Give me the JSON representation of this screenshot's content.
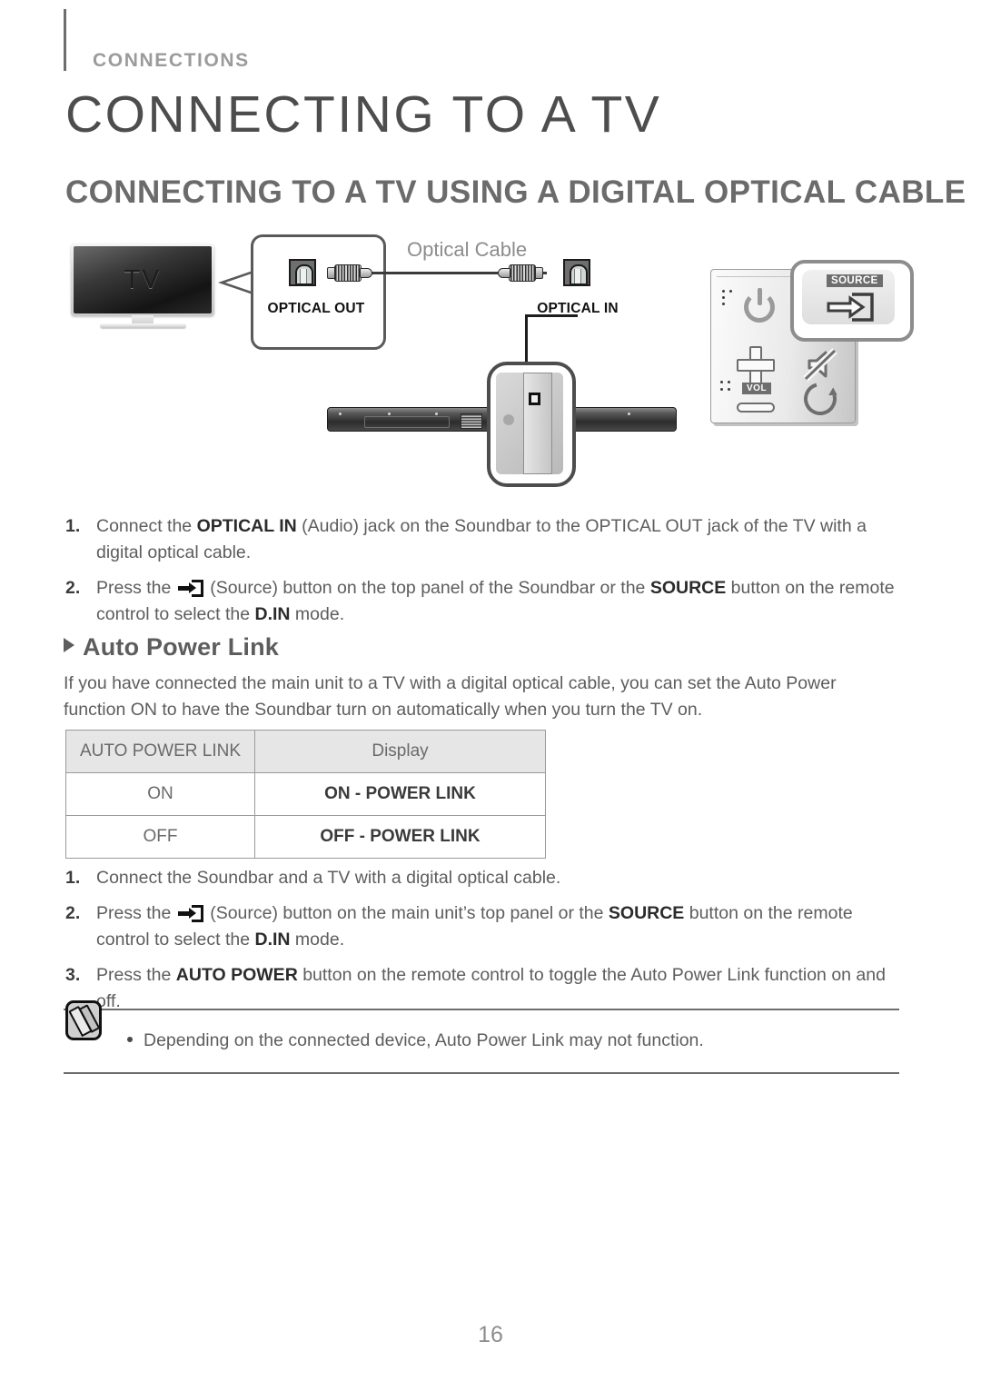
{
  "header": {
    "eyebrow": "CONNECTIONS"
  },
  "titles": {
    "h1": "CONNECTING TO A TV",
    "h2": "CONNECTING TO A TV USING A DIGITAL OPTICAL CABLE"
  },
  "diagram": {
    "tv_label": "TV",
    "optical_out_label": "OPTICAL OUT",
    "optical_in_label": "OPTICAL IN",
    "optical_cable_label": "Optical Cable",
    "source_badge": "SOURCE",
    "vol_badge": "VOL"
  },
  "steps_top": [
    {
      "num": "1.",
      "parts": [
        {
          "t": "Connect the ",
          "b": false
        },
        {
          "t": "OPTICAL IN",
          "b": true
        },
        {
          "t": " (Audio) jack on the Soundbar to the OPTICAL OUT jack of the TV with a digital optical cable.",
          "b": false
        }
      ]
    },
    {
      "num": "2.",
      "parts": [
        {
          "t": "Press the ",
          "b": false
        },
        {
          "t": "[SOURCE-ICON]",
          "b": false,
          "icon": "source-icon"
        },
        {
          "t": " (Source) button on the top panel of the Soundbar or the ",
          "b": false
        },
        {
          "t": "SOURCE",
          "b": true
        },
        {
          "t": " button on the remote control to select the ",
          "b": false
        },
        {
          "t": "D.IN",
          "b": true
        },
        {
          "t": " mode.",
          "b": false
        }
      ]
    }
  ],
  "subhead": {
    "label": "Auto Power Link"
  },
  "intro_paragraph": "If you have connected the main unit to a TV with a digital optical cable, you can set the Auto Power function ON to have the Soundbar turn on automatically when you turn the TV on.",
  "table": {
    "headers": [
      "AUTO POWER LINK",
      "Display"
    ],
    "rows": [
      {
        "setting": "ON",
        "display": "ON - POWER LINK"
      },
      {
        "setting": "OFF",
        "display": "OFF - POWER LINK"
      }
    ]
  },
  "steps_bottom": [
    {
      "num": "1.",
      "parts": [
        {
          "t": "Connect the Soundbar and a TV with a digital optical cable.",
          "b": false
        }
      ]
    },
    {
      "num": "2.",
      "parts": [
        {
          "t": "Press the ",
          "b": false
        },
        {
          "t": "[SOURCE-ICON]",
          "b": false,
          "icon": "source-icon"
        },
        {
          "t": " (Source) button on the main unit’s top panel or the ",
          "b": false
        },
        {
          "t": "SOURCE",
          "b": true
        },
        {
          "t": " button on the remote control to select the ",
          "b": false
        },
        {
          "t": "D.IN",
          "b": true
        },
        {
          "t": " mode.",
          "b": false
        }
      ]
    },
    {
      "num": "3.",
      "parts": [
        {
          "t": "Press the ",
          "b": false
        },
        {
          "t": "AUTO POWER",
          "b": true
        },
        {
          "t": " button on the remote control to toggle the Auto Power Link function on and off.",
          "b": false
        }
      ]
    }
  ],
  "note": {
    "text": "Depending on the connected device, Auto Power Link may not function."
  },
  "footer": {
    "page_number": "16"
  },
  "colors": {
    "text": "#5d5d5d",
    "title": "#4d4d4d",
    "rule": "#6d6d6d",
    "table_header_bg": "#e6e6e6"
  }
}
